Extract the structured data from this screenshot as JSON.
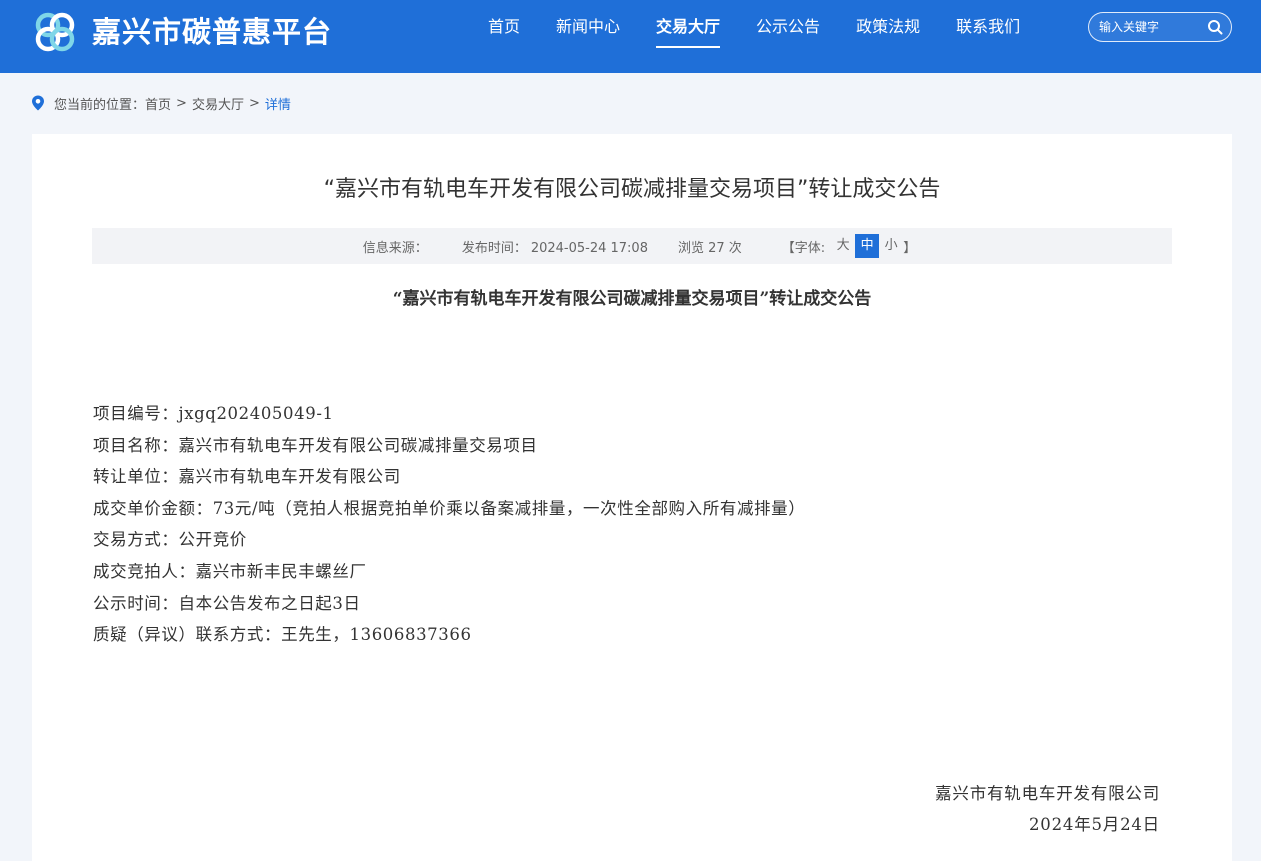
{
  "header": {
    "site_title": "嘉兴市碳普惠平台",
    "nav": [
      {
        "label": "首页",
        "active": false
      },
      {
        "label": "新闻中心",
        "active": false
      },
      {
        "label": "交易大厅",
        "active": true
      },
      {
        "label": "公示公告",
        "active": false
      },
      {
        "label": "政策法规",
        "active": false
      },
      {
        "label": "联系我们",
        "active": false
      }
    ],
    "search_placeholder": "输入关键字",
    "search_icon": "search-icon",
    "brand_color": "#1f6fd8"
  },
  "breadcrumb": {
    "prefix": "您当前的位置：",
    "items": [
      "首页",
      "交易大厅"
    ],
    "current": "详情",
    "separator": ">"
  },
  "article": {
    "title": "“嘉兴市有轨电车开发有限公司碳减排量交易项目”转让成交公告",
    "meta": {
      "source_label": "信息来源：",
      "source_value": "",
      "publish_label": "发布时间：",
      "publish_value": "2024-05-24 17:08",
      "views_text": "浏览 27 次",
      "font_label": "【字体:",
      "font_sizes": [
        "大",
        "中",
        "小"
      ],
      "font_active": "中",
      "font_close": "】"
    },
    "subtitle": "“嘉兴市有轨电车开发有限公司碳减排量交易项目”转让成交公告",
    "lines": [
      "项目编号：jxgq202405049-1",
      "项目名称：嘉兴市有轨电车开发有限公司碳减排量交易项目",
      "转让单位：嘉兴市有轨电车开发有限公司",
      "成交单价金额：73元/吨（竞拍人根据竞拍单价乘以备案减排量，一次性全部购入所有减排量）",
      "交易方式：公开竞价",
      "成交竞拍人：嘉兴市新丰民丰螺丝厂",
      "公示时间：自本公告发布之日起3日",
      "质疑（异议）联系方式：王先生，13606837366"
    ],
    "signature": {
      "org": "嘉兴市有轨电车开发有限公司",
      "date": "2024年5月24日"
    }
  }
}
